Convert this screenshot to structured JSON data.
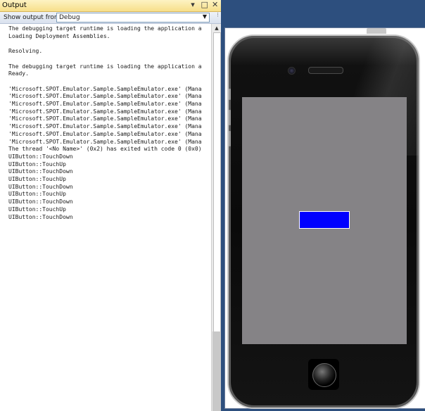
{
  "output_pane": {
    "title": "Output",
    "pin_glyph": "▾",
    "restore_glyph": "□",
    "close_glyph": "✕",
    "show_output_label": "Show output from:",
    "show_output_value": "Debug",
    "log_lines": [
      "The debugging target runtime is loading the application a",
      "Loading Deployment Assemblies.",
      "",
      "Resolving.",
      "",
      "The debugging target runtime is loading the application a",
      "Ready.",
      "",
      "'Microsoft.SPOT.Emulator.Sample.SampleEmulator.exe' (Mana",
      "'Microsoft.SPOT.Emulator.Sample.SampleEmulator.exe' (Mana",
      "'Microsoft.SPOT.Emulator.Sample.SampleEmulator.exe' (Mana",
      "'Microsoft.SPOT.Emulator.Sample.SampleEmulator.exe' (Mana",
      "'Microsoft.SPOT.Emulator.Sample.SampleEmulator.exe' (Mana",
      "'Microsoft.SPOT.Emulator.Sample.SampleEmulator.exe' (Mana",
      "'Microsoft.SPOT.Emulator.Sample.SampleEmulator.exe' (Mana",
      "'Microsoft.SPOT.Emulator.Sample.SampleEmulator.exe' (Mana",
      "The thread '<No Name>' (0x2) has exited with code 0 (0x0)",
      "UIButton::TouchDown",
      "UIButton::TouchUp",
      "UIButton::TouchDown",
      "UIButton::TouchUp",
      "UIButton::TouchDown",
      "UIButton::TouchUp",
      "UIButton::TouchDown",
      "UIButton::TouchUp",
      "UIButton::TouchDown"
    ]
  },
  "emulator": {
    "screen_color": "#858386",
    "touch_button_color": "#0000ff"
  },
  "icons": {
    "pin": "pin-icon",
    "restore": "restore-icon",
    "close": "close-icon",
    "dropdown": "chevron-down-icon",
    "scroll_up": "scroll-up-arrow-icon"
  }
}
